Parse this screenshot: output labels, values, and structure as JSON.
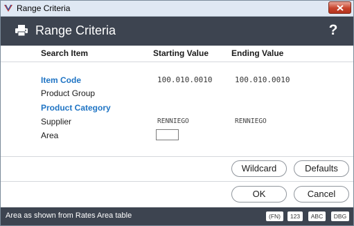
{
  "window": {
    "title": "Range Criteria",
    "close_icon": "close-icon"
  },
  "header": {
    "title": "Range Criteria",
    "help_label": "?",
    "icon": "printer-icon"
  },
  "columns": {
    "search_item": "Search Item",
    "starting_value": "Starting Value",
    "ending_value": "Ending Value"
  },
  "rows": [
    {
      "label": "Item Code",
      "start": "100.010.0010",
      "end": "100.010.0010"
    },
    {
      "label": "Product Group",
      "start": "",
      "end": ""
    },
    {
      "label": "Product Category",
      "start": "",
      "end": ""
    },
    {
      "label": "Supplier",
      "start": "RENNIEGO",
      "end": "RENNIEGO"
    },
    {
      "label": "Area",
      "start": "",
      "end": ""
    }
  ],
  "buttons": {
    "wildcard": "Wildcard",
    "defaults": "Defaults",
    "ok": "OK",
    "cancel": "Cancel"
  },
  "status": {
    "text": "Area as shown from Rates Area table",
    "badges": [
      "(FN)",
      "123",
      "ABC",
      "DBG"
    ]
  },
  "colors": {
    "header_bg": "#3d4450",
    "highlight_label": "#1f74c4",
    "titlebar_bg": "#dfe8f3",
    "close_red": "#c8442c"
  }
}
